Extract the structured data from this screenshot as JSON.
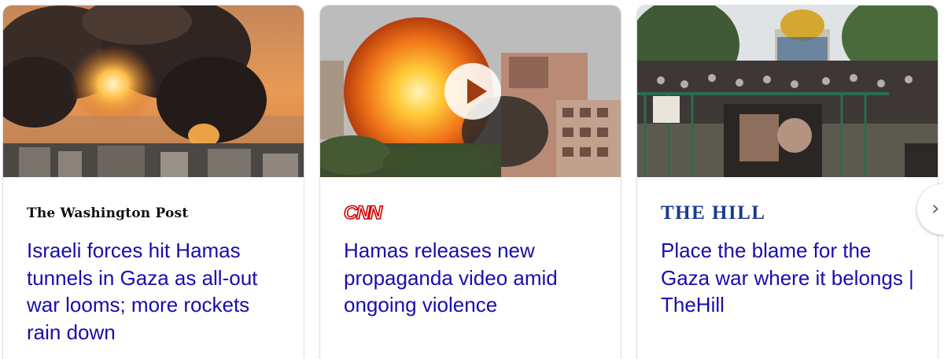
{
  "cards": [
    {
      "source": "The Washington Post",
      "headline": "Israeli forces hit Hamas tunnels in Gaza as all-out war looms; more rockets rain down",
      "has_video": false
    },
    {
      "source": "CNN",
      "headline": "Hamas releases new propaganda video amid ongoing violence",
      "has_video": true
    },
    {
      "source": "THE HILL",
      "headline": "Place the blame for the Gaza war where it belongs | TheHill",
      "has_video": false
    }
  ],
  "nav": {
    "next_icon": "chevron-right-icon",
    "next_glyph": "›"
  },
  "colors": {
    "headline_link": "#1a0dab",
    "card_border": "#dadce0",
    "cnn_red": "#cc0000",
    "hill_blue": "#1a3a8f"
  }
}
